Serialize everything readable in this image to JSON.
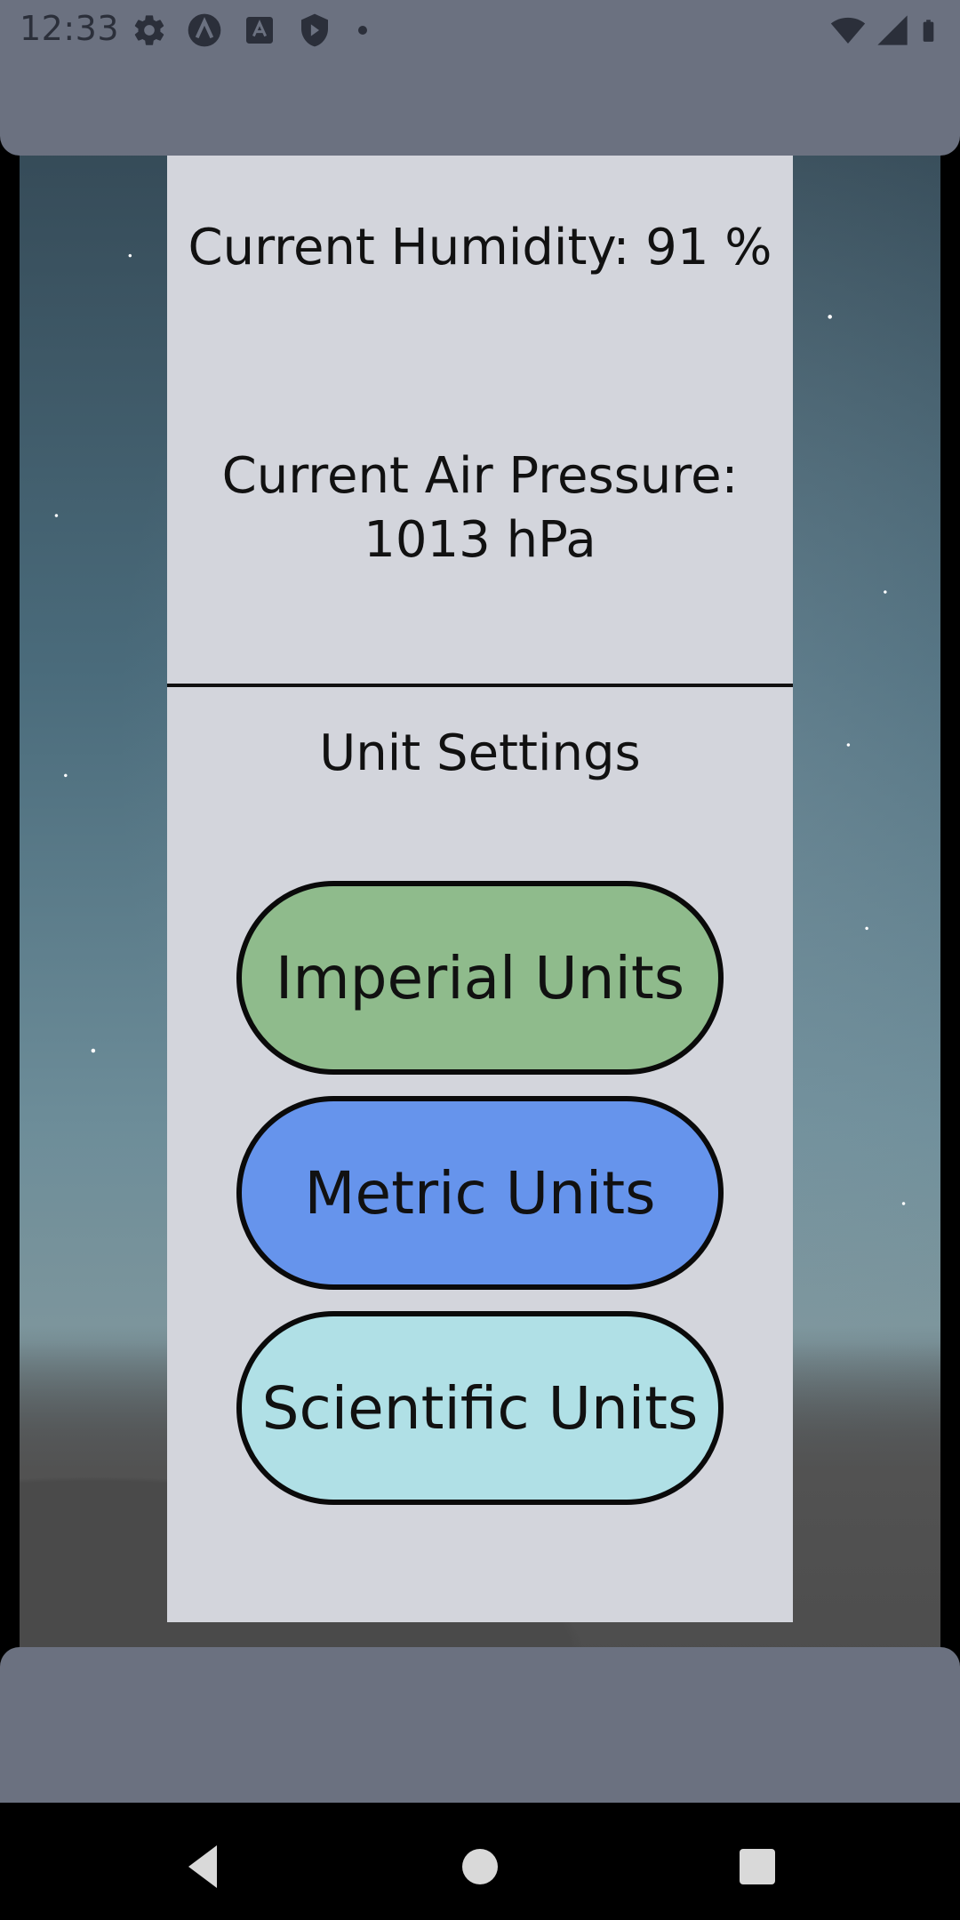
{
  "status_bar": {
    "time": "12:33",
    "left_icons": [
      "settings-gear-icon",
      "app-a-icon",
      "font-a-icon",
      "shield-icon",
      "dot-icon"
    ],
    "right_icons": [
      "wifi-icon",
      "signal-icon",
      "battery-icon"
    ]
  },
  "weather": {
    "humidity_text": "Current Humidity: 91 %",
    "pressure_line1": "Current Air Pressure:",
    "pressure_line2": "1013 hPa"
  },
  "units": {
    "heading": "Unit Settings",
    "imperial_label": "Imperial Units",
    "metric_label": "Metric Units",
    "scientific_label": "Scientific Units"
  },
  "colors": {
    "imperial": "#8fbb8c",
    "metric": "#6694ec",
    "scientific": "#b0e0e6",
    "card": "#d3d5dc",
    "panel": "#6b7180"
  },
  "nav_bar": {
    "icons": [
      "back-triangle-icon",
      "home-circle-icon",
      "recents-square-icon"
    ]
  }
}
